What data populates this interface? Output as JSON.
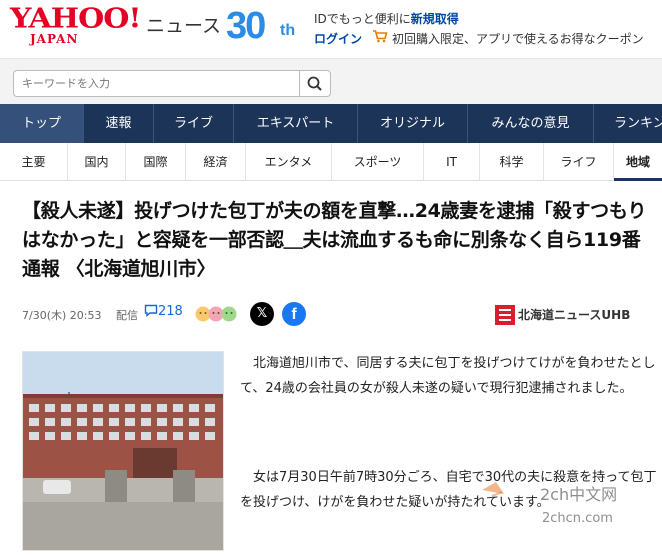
{
  "header": {
    "logo_main": "YAHOO!",
    "logo_sub": "JAPAN",
    "section": "ニュース",
    "anniversary_number": "30",
    "anniversary_suffix": "th",
    "id_promo_prefix": "IDでもっと便利に",
    "id_promo_link": "新規取得",
    "login": "ログイン",
    "coupon_text": "初回購入限定、アプリで使えるお得なクーポン"
  },
  "search": {
    "placeholder": "キーワードを入力"
  },
  "main_nav": [
    {
      "label": "トップ"
    },
    {
      "label": "速報"
    },
    {
      "label": "ライブ"
    },
    {
      "label": "エキスパート"
    },
    {
      "label": "オリジナル"
    },
    {
      "label": "みんなの意見"
    },
    {
      "label": "ランキング"
    }
  ],
  "sub_nav": [
    {
      "label": "主要"
    },
    {
      "label": "国内"
    },
    {
      "label": "国際"
    },
    {
      "label": "経済"
    },
    {
      "label": "エンタメ"
    },
    {
      "label": "スポーツ"
    },
    {
      "label": "IT"
    },
    {
      "label": "科学"
    },
    {
      "label": "ライフ"
    },
    {
      "label": "地域"
    }
  ],
  "article": {
    "title": "【殺人未遂】投げつけた包丁が夫の額を直撃…24歳妻を逮捕「殺すつもりはなかった」と容疑を一部否認＿夫は流血するも命に別条なく自ら119番通報 〈北海道旭川市〉",
    "date": "7/30(木) 20:53",
    "distribution": "配信",
    "comment_count": "218",
    "source": "北海道ニュースUHB",
    "paragraph1": "北海道旭川市で、同居する夫に包丁を投げつけてけがを負わせたとして、24歳の会社員の女が殺人未遂の疑いで現行犯逮捕されました。",
    "paragraph2": "女は7月30日午前7時30分ごろ、自宅で30代の夫に殺意を持って包丁を投げつけ、けがを負わせた疑いが持たれています。"
  },
  "watermark": {
    "line1": "2ch中文网",
    "line2": "2chcn.com"
  },
  "colors": {
    "brand_red": "#e60023",
    "nav_bg": "#1c3457",
    "link_blue": "#0047a5",
    "anniversary_blue": "#2a8ce6"
  },
  "icons": {
    "search": "search-icon",
    "cart": "cart-icon",
    "comment": "comment-icon",
    "x": "x-logo-icon",
    "facebook": "facebook-logo-icon"
  }
}
